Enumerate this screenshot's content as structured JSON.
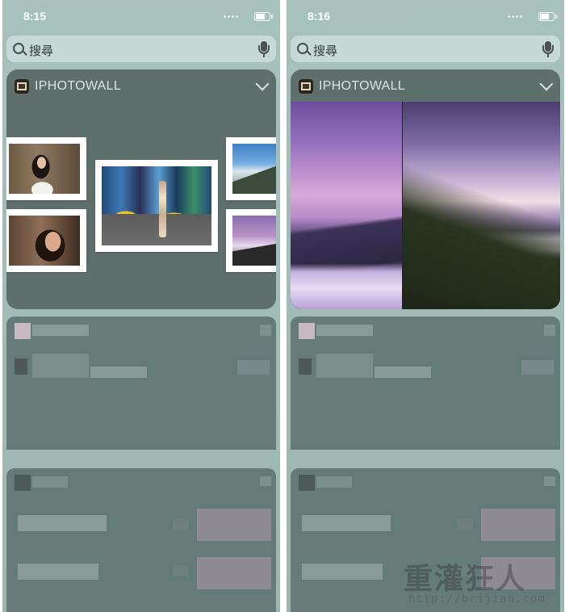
{
  "left": {
    "status": {
      "time": "8:15"
    },
    "search": {
      "placeholder": "搜尋"
    },
    "widget": {
      "title": "IPHOTOWALL",
      "photos": [
        {
          "name": "photo-portrait-1",
          "subject": "woman-portrait"
        },
        {
          "name": "photo-portrait-2",
          "subject": "smiling-woman"
        },
        {
          "name": "photo-city",
          "subject": "times-square-street"
        },
        {
          "name": "photo-landscape-1",
          "subject": "blue-sky-mountains"
        },
        {
          "name": "photo-landscape-2",
          "subject": "purple-sunset-clouds"
        }
      ]
    }
  },
  "right": {
    "status": {
      "time": "8:16"
    },
    "search": {
      "placeholder": "搜尋"
    },
    "widget": {
      "title": "IPHOTOWALL",
      "photos": [
        {
          "name": "panorama-left",
          "subject": "purple-sky-mountain"
        },
        {
          "name": "panorama-right",
          "subject": "sunrise-sea-of-clouds"
        }
      ]
    }
  },
  "watermark": {
    "logo": "重灌狂人",
    "url": "http://brijian.com"
  },
  "icons": [
    "search-icon",
    "microphone-icon",
    "chevron-down-icon",
    "battery-icon",
    "signal-dots-icon",
    "app-icon"
  ],
  "colors": {
    "background": "#a1bcb7",
    "widget": "#5f6f6c",
    "text_light": "#dbe3e1"
  }
}
